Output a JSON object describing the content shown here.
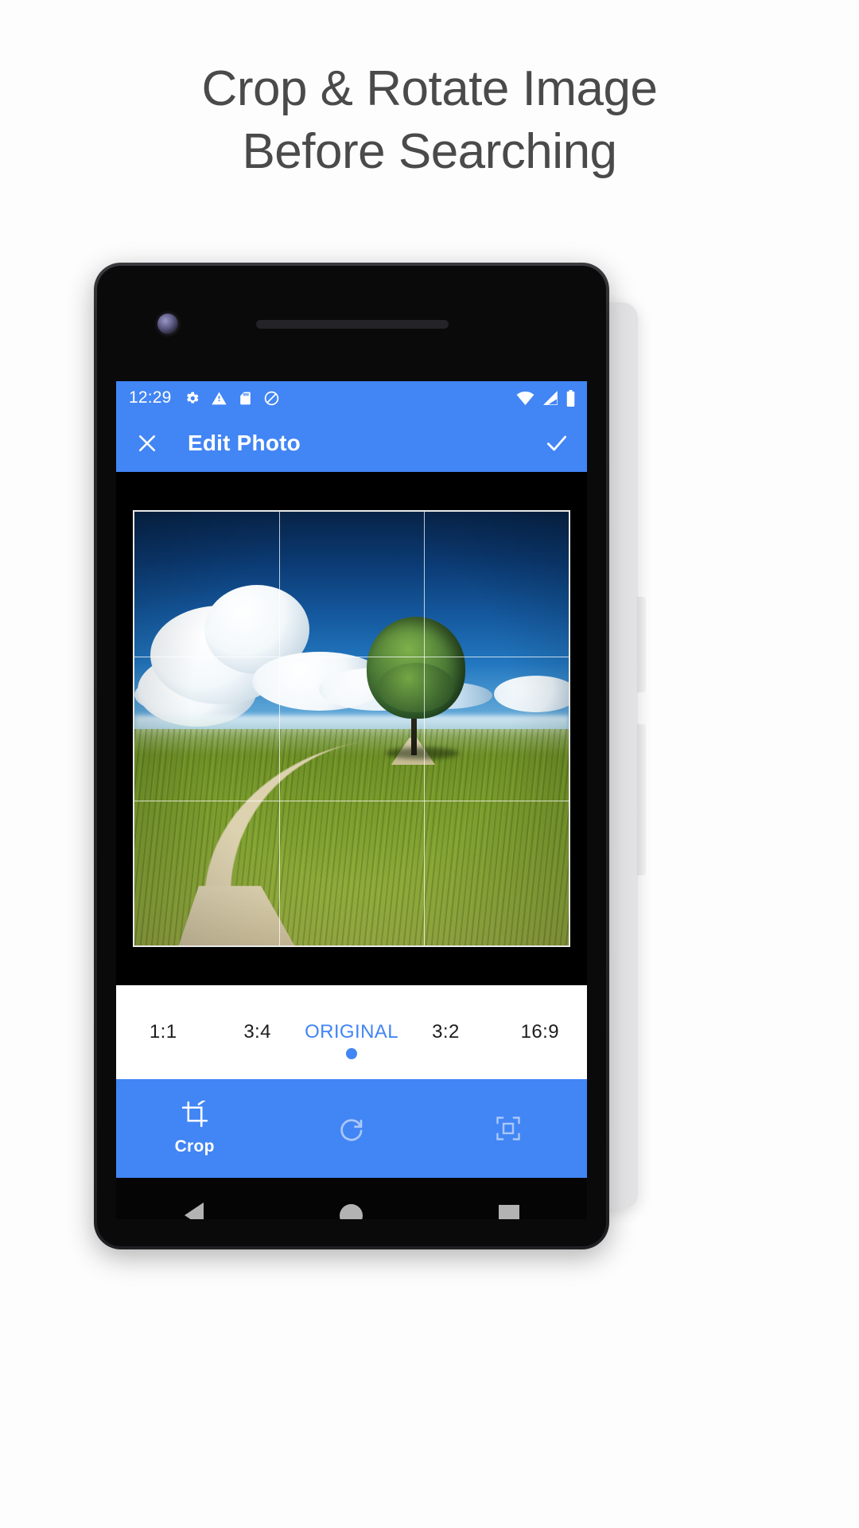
{
  "promo": {
    "headline_line1": "Crop & Rotate Image",
    "headline_line2": "Before Searching",
    "headline_color": "#4a4a4a",
    "background_color": "#ffffff"
  },
  "theme": {
    "accent": "#4285f4",
    "accent_text": "#ffffff",
    "canvas_bg": "#000000",
    "strip_bg": "#ffffff"
  },
  "phone": {
    "device_color": "#202024",
    "nav": {
      "back_label": "Back",
      "home_label": "Home",
      "recents_label": "Recent apps"
    }
  },
  "status_bar": {
    "time": "12:29",
    "left_icons": [
      "gear-icon",
      "warning-triangle-icon",
      "sd-card-icon",
      "do-not-disturb-icon"
    ],
    "right_icons": [
      "wifi-icon",
      "cell-signal-icon",
      "battery-icon"
    ]
  },
  "app_bar": {
    "close_icon": "close-icon",
    "title": "Edit Photo",
    "confirm_icon": "check-icon"
  },
  "editor": {
    "photo_alt": "Lone tree on grassy hill with dirt path and clouds",
    "grid_overlay": "rule-of-thirds"
  },
  "aspect_ratios": {
    "items": [
      {
        "label": "1:1",
        "selected": false
      },
      {
        "label": "3:4",
        "selected": false
      },
      {
        "label": "ORIGINAL",
        "selected": true
      },
      {
        "label": "3:2",
        "selected": false
      },
      {
        "label": "16:9",
        "selected": false
      }
    ]
  },
  "toolbar": {
    "items": [
      {
        "icon": "crop-icon",
        "label": "Crop",
        "active": true
      },
      {
        "icon": "rotate-right-icon",
        "label": "",
        "active": false
      },
      {
        "icon": "scale-fit-icon",
        "label": "",
        "active": false
      }
    ]
  }
}
